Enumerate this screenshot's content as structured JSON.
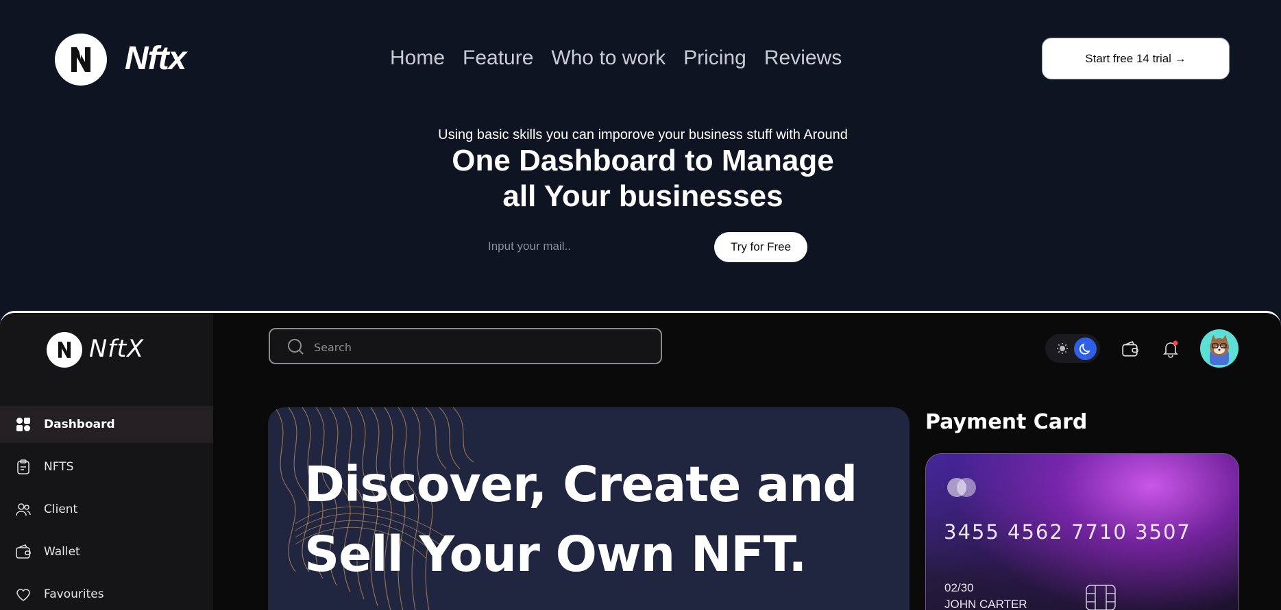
{
  "header": {
    "logo_icon": "n-letter-logo-icon",
    "brand": "Nftx",
    "nav": [
      "Home",
      "Feature",
      "Who to work",
      "Pricing",
      "Reviews"
    ],
    "cta_label": "Start free 14 trial →"
  },
  "hero": {
    "tagline": "Using basic skills you can imporove your business stuff with Around",
    "title": "One Dashboard to Manage\nall Your businesses",
    "email_placeholder": "Input your mail..",
    "try_label": "Try for Free"
  },
  "dashboard": {
    "brand": "NftX",
    "menu": [
      {
        "label": "Dashboard",
        "icon": "grid-icon",
        "active": true
      },
      {
        "label": "NFTS",
        "icon": "clipboard-icon",
        "active": false
      },
      {
        "label": "Client",
        "icon": "users-icon",
        "active": false
      },
      {
        "label": "Wallet",
        "icon": "wallet-icon",
        "active": false
      },
      {
        "label": "Favourites",
        "icon": "heart-icon",
        "active": false
      }
    ],
    "search_placeholder": "Search",
    "theme": "dark",
    "notification_dot": true,
    "banner_title": "Discover, Create and\nSell Your Own NFT.",
    "payment": {
      "title": "Payment Card",
      "card_number": "3455 4562 7710 3507",
      "expiry": "02/30",
      "holder": "JOHN CARTER"
    }
  },
  "colors": {
    "page_bg": "#0e1422",
    "dash_bg": "#0a0a0b",
    "sidebar_bg": "#151518",
    "active_item_bg": "#231f22",
    "banner_bg": "#20263f",
    "accent_blue": "#2e5fe8",
    "avatar_bg": "#5ce0d6",
    "notification_red": "#ff4444"
  }
}
